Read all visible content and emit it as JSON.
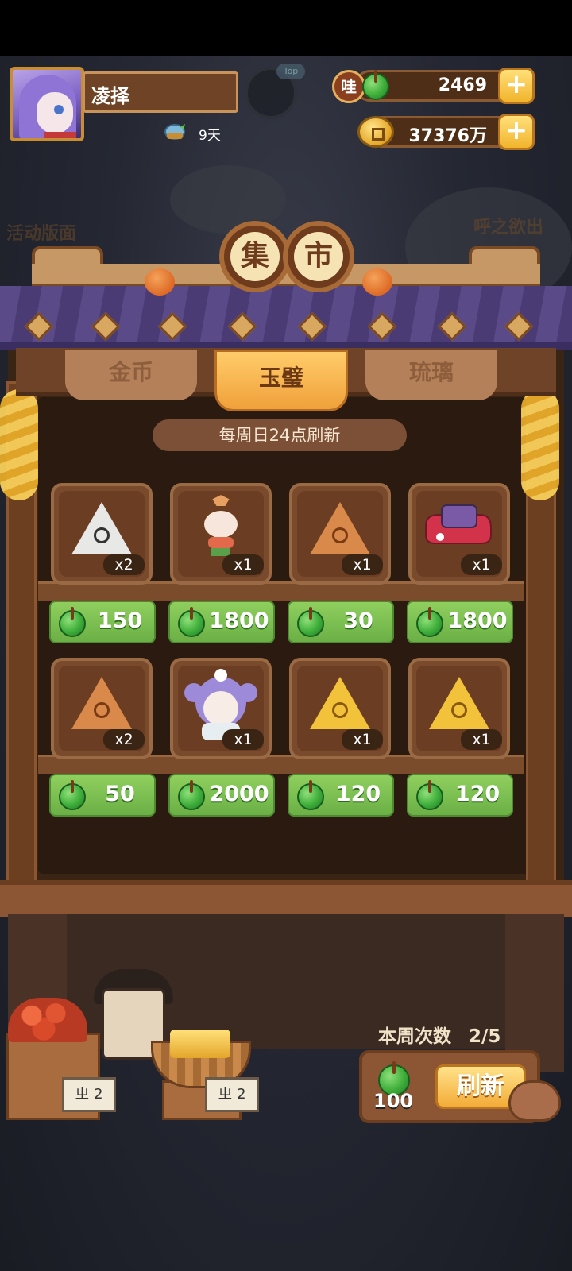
{
  "player": {
    "name": "凌择",
    "streak": "9天",
    "rank_tag": "Top"
  },
  "resources": {
    "jade_badge": "哇",
    "jade_amount": "2469",
    "coin_amount": "37376万",
    "plus_label": "+"
  },
  "side_buttons": {
    "left": "活动版面",
    "right": "呼之欲出"
  },
  "market": {
    "title_chars": [
      "集",
      "市"
    ],
    "tabs": [
      {
        "label": "金币",
        "active": false
      },
      {
        "label": "玉璧",
        "active": true
      },
      {
        "label": "琉璃",
        "active": false
      }
    ],
    "refresh_note": "每周日24点刷新",
    "items": [
      {
        "icon": "white-triangle-cake-icon",
        "qty": "x2",
        "price": "150"
      },
      {
        "icon": "lantern-figure-icon",
        "qty": "x1",
        "price": "1800"
      },
      {
        "icon": "orange-triangle-wheel-icon",
        "qty": "x1",
        "price": "30"
      },
      {
        "icon": "red-shoe-block-icon",
        "qty": "x1",
        "price": "1800"
      },
      {
        "icon": "orange-triangle-sun-icon",
        "qty": "x2",
        "price": "50"
      },
      {
        "icon": "character-portrait-icon",
        "qty": "x1",
        "price": "2000"
      },
      {
        "icon": "yellow-triangle-swirl-icon",
        "qty": "x1",
        "price": "120"
      },
      {
        "icon": "yellow-triangle-star-icon",
        "qty": "x1",
        "price": "120"
      }
    ],
    "weekly_label": "本周次数",
    "weekly_count": "2/5",
    "refresh_cost": "100",
    "refresh_button": "刷新"
  },
  "stall_tags": {
    "left": "ㄓ 2",
    "right": "ㄓ 2"
  },
  "colors": {
    "jade": "#3fae3a",
    "price_button": "#7bbd50",
    "active_tab": "#f5b54c",
    "wood": "#6e4327"
  }
}
